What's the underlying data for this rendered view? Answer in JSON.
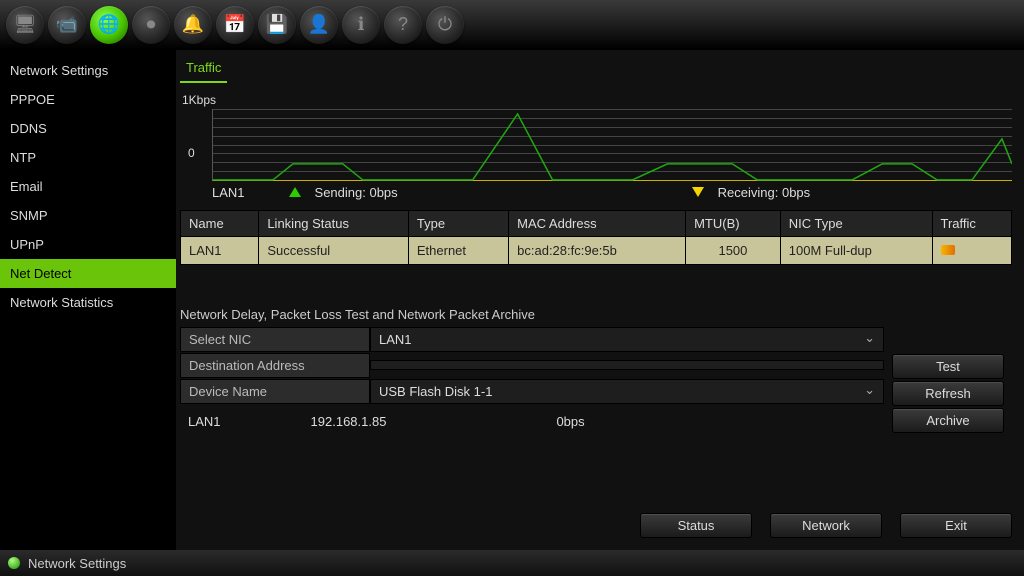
{
  "sidebar": {
    "items": [
      {
        "label": "Network Settings"
      },
      {
        "label": "PPPOE"
      },
      {
        "label": "DDNS"
      },
      {
        "label": "NTP"
      },
      {
        "label": "Email"
      },
      {
        "label": "SNMP"
      },
      {
        "label": "UPnP"
      },
      {
        "label": "Net Detect"
      },
      {
        "label": "Network Statistics"
      }
    ],
    "active_index": 7
  },
  "tab": {
    "label": "Traffic"
  },
  "graph": {
    "y_max_label": "1Kbps",
    "y_min_label": "0",
    "interface_label": "LAN1",
    "sending_label": "Sending: 0bps",
    "receiving_label": "Receiving: 0bps"
  },
  "table": {
    "headers": [
      "Name",
      "Linking Status",
      "Type",
      "MAC Address",
      "MTU(B)",
      "NIC Type",
      "Traffic"
    ],
    "rows": [
      {
        "name": "LAN1",
        "status": "Successful",
        "type": "Ethernet",
        "mac": "bc:ad:28:fc:9e:5b",
        "mtu": "1500",
        "nic": "100M Full-dup"
      }
    ]
  },
  "section": {
    "title": "Network Delay, Packet Loss Test and Network Packet Archive"
  },
  "form": {
    "select_nic_label": "Select NIC",
    "select_nic_value": "LAN1",
    "dest_label": "Destination Address",
    "dest_value": "",
    "device_label": "Device Name",
    "device_value": "USB Flash Disk 1-1"
  },
  "info": {
    "iface": "LAN1",
    "ip": "192.168.1.85",
    "rate": "0bps"
  },
  "buttons": {
    "test": "Test",
    "refresh": "Refresh",
    "archive": "Archive",
    "status": "Status",
    "network": "Network",
    "exit": "Exit"
  },
  "statusbar": {
    "text": "Network Settings"
  },
  "toolbar_icons": [
    "monitor-icon",
    "camera-icon",
    "network-icon",
    "record-icon",
    "alarm-icon",
    "event-icon",
    "hdd-icon",
    "user-icon",
    "info-icon",
    "help-icon",
    "power-icon"
  ],
  "toolbar_glyphs": [
    "🖥",
    "📹",
    "🌐",
    "⏺",
    "🔔",
    "📅",
    "💾",
    "👤",
    "ℹ",
    "?",
    "⏻"
  ],
  "toolbar_active_index": 2
}
